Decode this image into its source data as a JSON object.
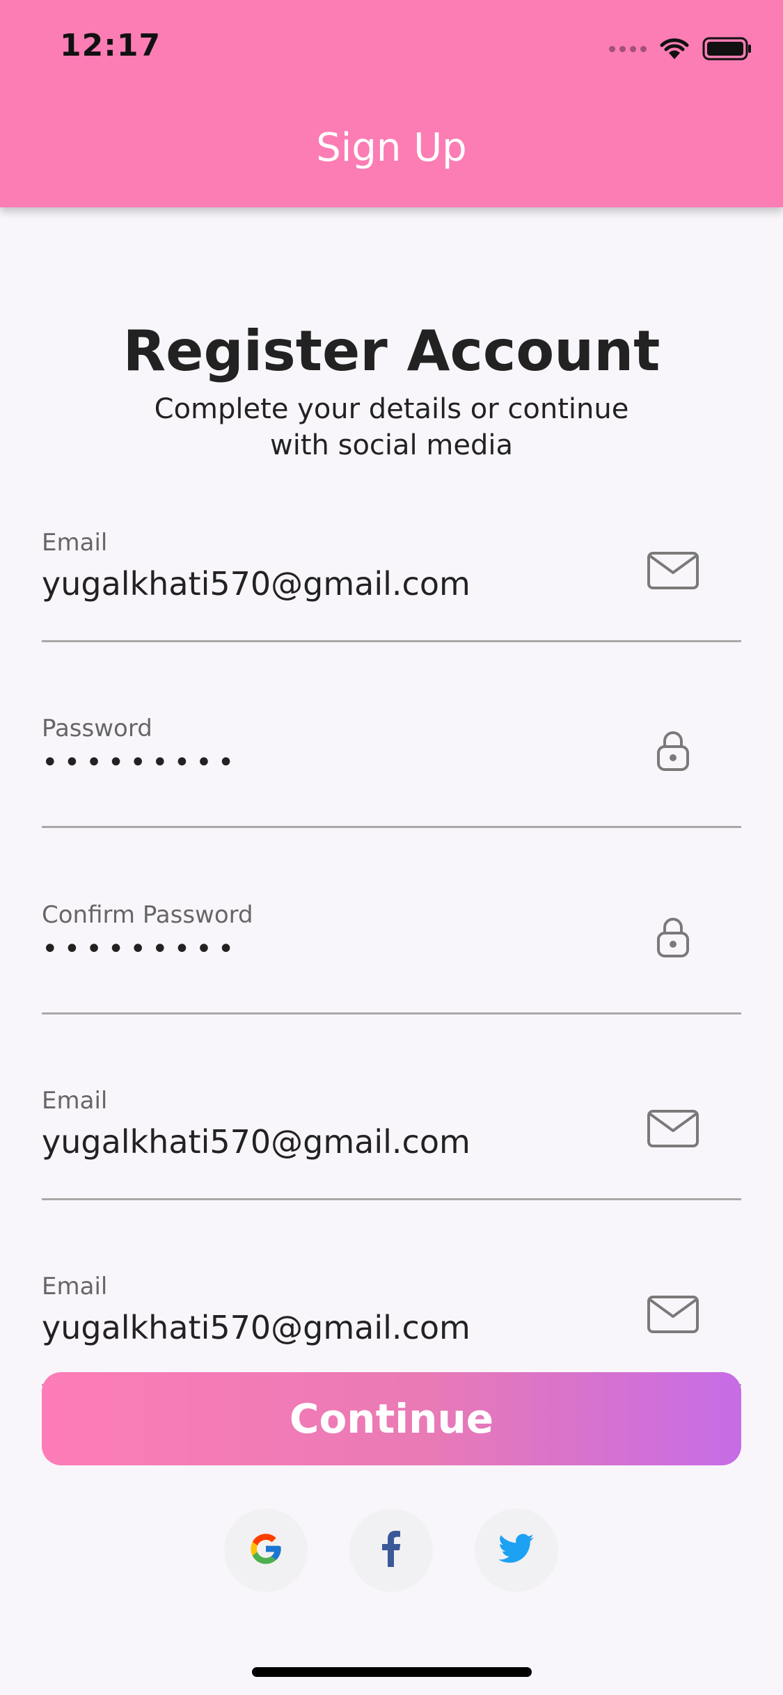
{
  "status_bar": {
    "time": "12:17"
  },
  "header": {
    "title": "Sign Up"
  },
  "main": {
    "title": "Register Account",
    "subtitle": "Complete your details or continue with social media"
  },
  "fields": [
    {
      "label": "Email",
      "value": "yugalkhati570@gmail.com",
      "icon": "mail-icon"
    },
    {
      "label": "Password",
      "value": "•••••••••",
      "icon": "lock-icon"
    },
    {
      "label": "Confirm Password",
      "value": "•••••••••",
      "icon": "lock-icon"
    },
    {
      "label": "Email",
      "value": "yugalkhati570@gmail.com",
      "icon": "mail-icon"
    },
    {
      "label": "Email",
      "value": "yugalkhati570@gmail.com",
      "icon": "mail-icon"
    }
  ],
  "actions": {
    "continue_label": "Continue"
  },
  "social": {
    "icons": [
      "google-icon",
      "facebook-icon",
      "twitter-icon"
    ]
  },
  "colors": {
    "header": "#fb7db4",
    "button_start": "#fd7cb7",
    "button_end": "#c66ce6",
    "facebook": "#3b5998",
    "twitter": "#1da1f2"
  }
}
